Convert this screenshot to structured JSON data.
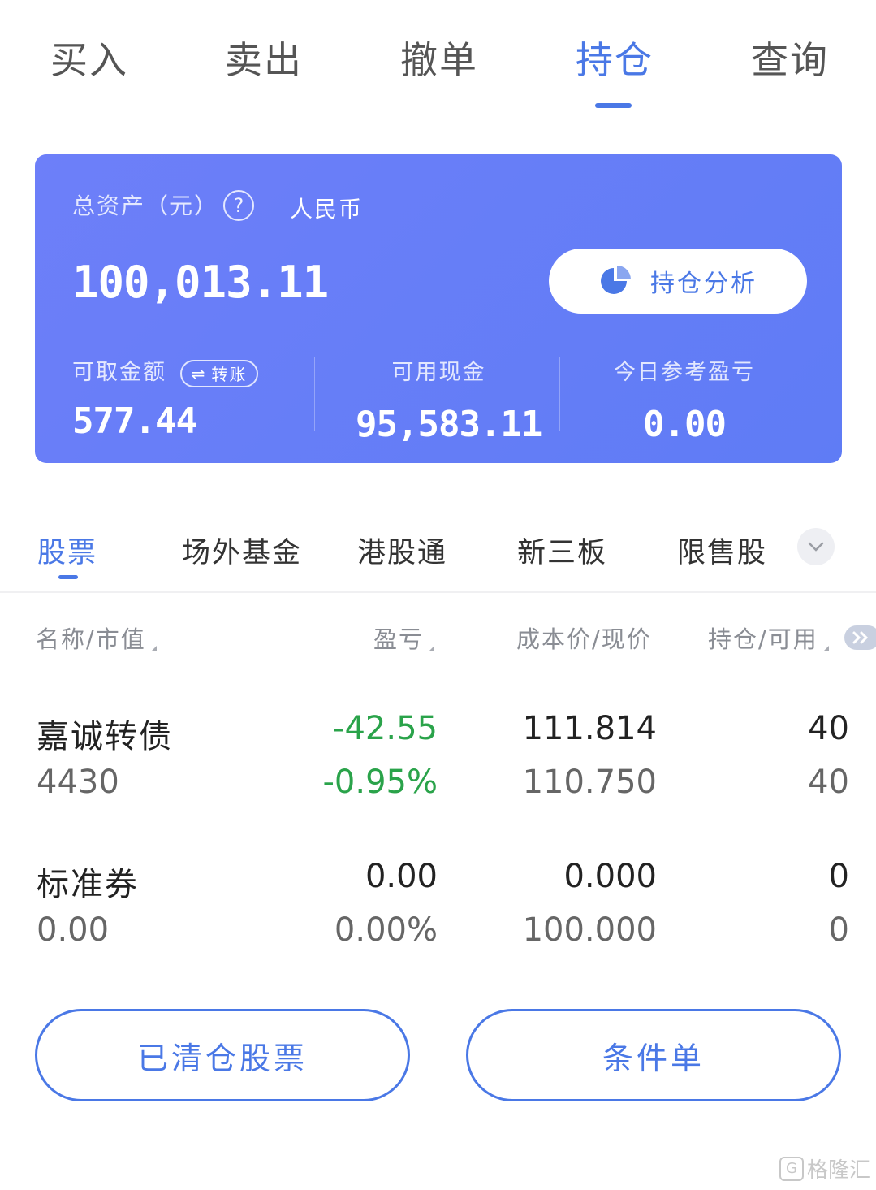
{
  "top_tabs": [
    "买入",
    "卖出",
    "撤单",
    "持仓",
    "查询"
  ],
  "active_top_tab": "持仓",
  "asset_card": {
    "label": "总资产（元）",
    "help_icon": "?",
    "currency": "人民币",
    "total": "100,013.11",
    "analysis_button": "持仓分析",
    "withdrawable_label": "可取金额",
    "transfer_label": "转账",
    "transfer_icon": "⇌",
    "withdrawable_value": "577.44",
    "cash_label": "可用现金",
    "cash_value": "95,583.11",
    "today_pl_label": "今日参考盈亏",
    "today_pl_value": "0.00",
    "bg_color": "#6b7ff8"
  },
  "category_tabs": [
    "股票",
    "场外基金",
    "港股通",
    "新三板",
    "限售股"
  ],
  "table": {
    "headers": [
      "名称/市值",
      "盈亏",
      "成本价/现价",
      "持仓/可用"
    ],
    "rows": [
      {
        "name": "嘉诚转债",
        "market_value": "4430",
        "pl": "-42.55",
        "pl_pct": "-0.95%",
        "cost": "111.814",
        "price": "110.750",
        "hold": "40",
        "avail": "40"
      },
      {
        "name": "标准券",
        "market_value": "0.00",
        "pl": "0.00",
        "pl_pct": "0.00%",
        "cost": "0.000",
        "price": "100.000",
        "hold": "0",
        "avail": "0"
      }
    ]
  },
  "bottom_buttons": [
    "已清仓股票",
    "条件单"
  ],
  "watermark": {
    "logo": "G",
    "text": "格隆汇"
  },
  "colors": {
    "accent": "#4a78e6",
    "loss": "#2aa34a"
  }
}
